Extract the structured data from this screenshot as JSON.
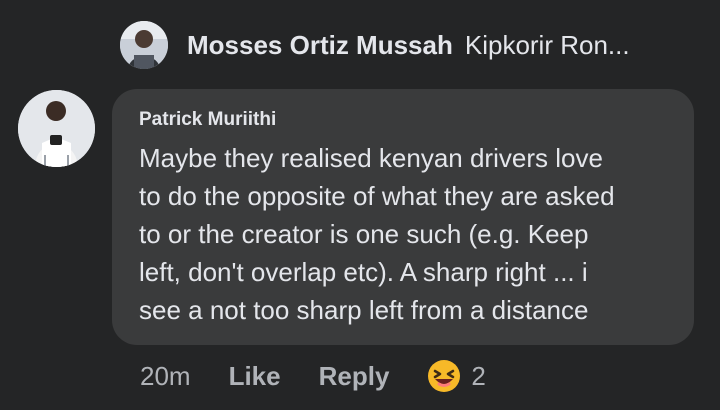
{
  "reply_preview": {
    "author": "Mosses Ortiz Mussah",
    "text": "Kipkorir Ron..."
  },
  "comment": {
    "author": "Patrick Muriithi",
    "lines": [
      "Maybe they realised kenyan drivers love",
      "to do the opposite of what they are asked",
      "to or the creator is one such (e.g. Keep",
      "left, don't overlap etc). A sharp right ... i",
      "see a not too sharp left from a distance"
    ]
  },
  "actions": {
    "time": "20m",
    "like_label": "Like",
    "reply_label": "Reply",
    "reaction_icon": "laughing-face-emoji",
    "reaction_count": "2"
  },
  "colors": {
    "background": "#242526",
    "bubble": "#3a3b3c",
    "primary_text": "#e4e6eb",
    "secondary_text": "#b0b3b8",
    "emoji_yellow": "#f7b928"
  }
}
